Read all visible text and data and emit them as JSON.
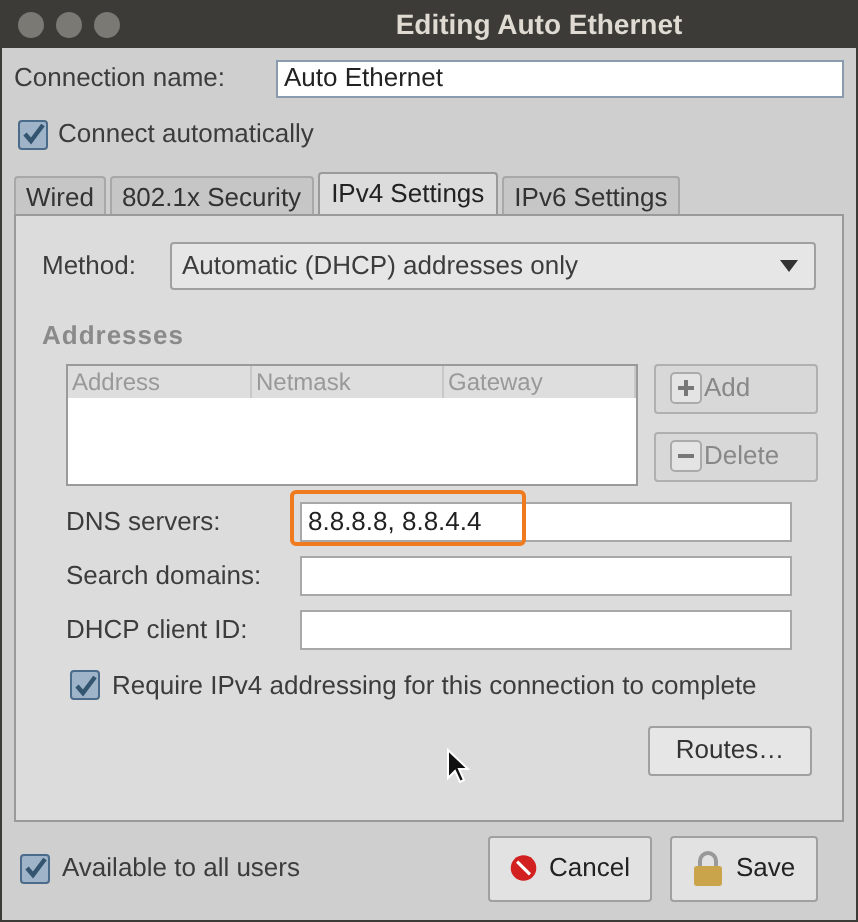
{
  "window": {
    "title": "Editing Auto Ethernet"
  },
  "connection_name": {
    "label": "Connection name:",
    "value": "Auto Ethernet"
  },
  "connect_automatically": {
    "label": "Connect automatically",
    "checked": true
  },
  "tabs": [
    {
      "label": "Wired",
      "selected": false
    },
    {
      "label": "802.1x Security",
      "selected": false
    },
    {
      "label": "IPv4 Settings",
      "selected": true
    },
    {
      "label": "IPv6 Settings",
      "selected": false
    }
  ],
  "method": {
    "label": "Method:",
    "value": "Automatic (DHCP) addresses only"
  },
  "addresses": {
    "heading": "Addresses",
    "columns": [
      "Address",
      "Netmask",
      "Gateway"
    ],
    "buttons": [
      {
        "label": "Add",
        "kind": "add",
        "disabled": true
      },
      {
        "label": "Delete",
        "kind": "delete",
        "disabled": true
      }
    ]
  },
  "fields": [
    {
      "label": "DNS servers:",
      "value": "8.8.8.8, 8.8.4.4",
      "highlighted": true
    },
    {
      "label": "Search domains:",
      "highlighted": false
    },
    {
      "label": "DHCP client ID:",
      "highlighted": false
    }
  ],
  "require_ipv4": {
    "label": "Require IPv4 addressing for this connection to complete",
    "checked": true
  },
  "routes_button": "Routes…",
  "available_to_all": {
    "label": "Available to all users",
    "checked": true
  },
  "buttons": [
    {
      "label": "Cancel",
      "kind": "cancel"
    },
    {
      "label": "Save",
      "kind": "save"
    }
  ]
}
